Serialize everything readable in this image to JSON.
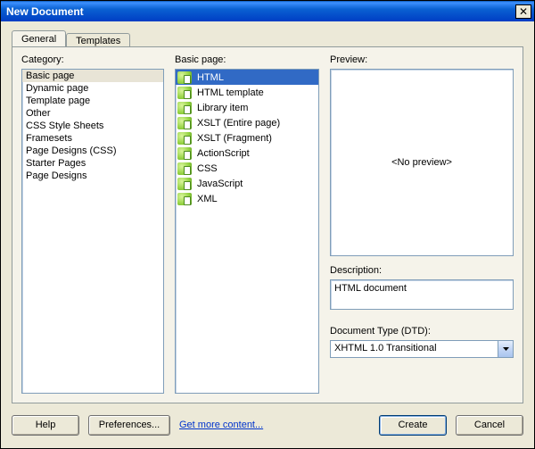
{
  "window_title": "New Document",
  "tabs": {
    "general": "General",
    "templates": "Templates"
  },
  "labels": {
    "category": "Category:",
    "basic_page": "Basic page:",
    "preview": "Preview:",
    "description": "Description:",
    "doctype": "Document Type (DTD):"
  },
  "categories": [
    "Basic page",
    "Dynamic page",
    "Template page",
    "Other",
    "CSS Style Sheets",
    "Framesets",
    "Page Designs (CSS)",
    "Starter Pages",
    "Page Designs"
  ],
  "category_selected_index": 0,
  "basic_pages": [
    "HTML",
    "HTML template",
    "Library item",
    "XSLT (Entire page)",
    "XSLT (Fragment)",
    "ActionScript",
    "CSS",
    "JavaScript",
    "XML"
  ],
  "basic_page_selected_index": 0,
  "preview_text": "<No preview>",
  "description_text": "HTML document",
  "doctype_value": "XHTML 1.0 Transitional",
  "buttons": {
    "help": "Help",
    "preferences": "Preferences...",
    "get_more": "Get more content...",
    "create": "Create",
    "cancel": "Cancel"
  }
}
